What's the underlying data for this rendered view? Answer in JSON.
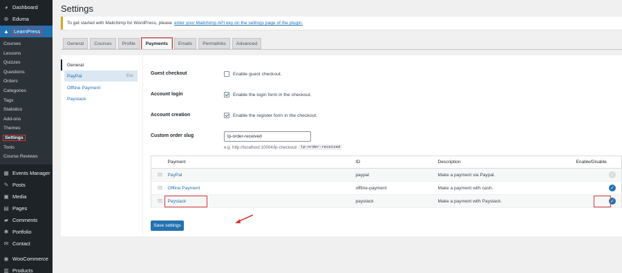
{
  "sidebar": {
    "top_items": [
      {
        "label": "Dashboard",
        "icon": "dashboard-icon"
      },
      {
        "label": "Eduma",
        "icon": "eduma-icon"
      },
      {
        "label": "LearnPress",
        "icon": "learnpress-icon"
      }
    ],
    "submenu": [
      "Courses",
      "Lessons",
      "Quizzes",
      "Questions",
      "Orders",
      "Categories",
      "Tags",
      "Statistics",
      "Add-ons",
      "Themes",
      "Settings",
      "Tools",
      "Course Reviews"
    ],
    "bottom_items": [
      {
        "label": "Events Manager",
        "icon": "calendar-icon"
      },
      {
        "label": "Posts",
        "icon": "pin-icon"
      },
      {
        "label": "Media",
        "icon": "media-icon"
      },
      {
        "label": "Pages",
        "icon": "page-icon"
      },
      {
        "label": "Comments",
        "icon": "comment-icon"
      },
      {
        "label": "Portfolio",
        "icon": "portfolio-icon"
      },
      {
        "label": "Contact",
        "icon": "mail-icon"
      },
      {
        "label": "WooCommerce",
        "icon": "woocommerce-icon"
      },
      {
        "label": "Products",
        "icon": "products-icon"
      }
    ]
  },
  "page": {
    "title": "Settings",
    "notice_text": "To get started with Mailchimp for WordPress, please",
    "notice_link": "enter your Mailchimp API key on the settings page of the plugin."
  },
  "tabs": [
    "General",
    "Courses",
    "Profile",
    "Payments",
    "Emails",
    "Permalinks",
    "Advanced"
  ],
  "subnav": {
    "general": "General",
    "dragging": "PayPal",
    "dragging_key": "Esc",
    "offline": "Offline Payment",
    "paystack": "Paystack"
  },
  "form": {
    "guest_checkout_label": "Guest checkout",
    "guest_checkout_text": "Enable guest checkout.",
    "guest_checkout_checked": false,
    "account_login_label": "Account login",
    "account_login_text": "Enable the login form in the checkout.",
    "account_login_checked": true,
    "account_creation_label": "Account creation",
    "account_creation_text": "Enable the register form in the checkout.",
    "account_creation_checked": true,
    "slug_label": "Custom order slug",
    "slug_value": "lp-order-received",
    "slug_hint": "e.g. http://localhost:10004/lp-checkout/",
    "slug_hint_code": "lp-order-received"
  },
  "table": {
    "headers": [
      "Payment",
      "ID",
      "Description",
      "Enable/Disable"
    ],
    "rows": [
      {
        "payment": "PayPal",
        "id": "paypal",
        "description": "Make a payment via Paypal.",
        "enabled": false
      },
      {
        "payment": "Offline Payment",
        "id": "offline-payment",
        "description": "Make a payment with cash.",
        "enabled": true
      },
      {
        "payment": "Paystack",
        "id": "paystack",
        "description": "Make a payment with Paystack.",
        "enabled": true
      }
    ]
  },
  "save_label": "Save settings",
  "colors": {
    "accent": "#2271b1",
    "highlight": "#d63638",
    "sidebar": "#1d2327"
  }
}
